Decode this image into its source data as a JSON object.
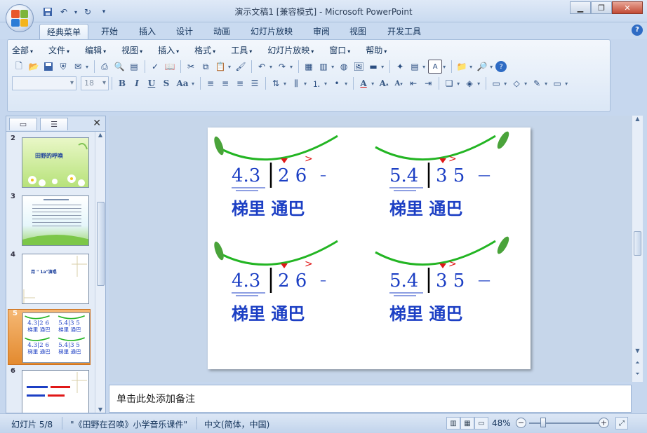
{
  "window": {
    "title": "演示文稿1 [兼容模式] - Microsoft PowerPoint",
    "controls": [
      "minimize",
      "restore",
      "close"
    ]
  },
  "quick_access": [
    {
      "name": "save-icon"
    },
    {
      "name": "undo-icon"
    },
    {
      "name": "redo-icon"
    },
    {
      "name": "customize-icon"
    }
  ],
  "tabs": [
    "经典菜单",
    "开始",
    "插入",
    "设计",
    "动画",
    "幻灯片放映",
    "审阅",
    "视图",
    "开发工具"
  ],
  "active_tab": "经典菜单",
  "menus": [
    "全部",
    "文件",
    "编辑",
    "视图",
    "插入",
    "格式",
    "工具",
    "幻灯片放映",
    "窗口",
    "帮助"
  ],
  "format": {
    "font_name": "",
    "font_size": "18",
    "bold": "B",
    "italic": "I",
    "underline": "U",
    "strike": "S",
    "case": "Aa"
  },
  "slides": [
    {
      "number": "2",
      "title": "田野的呼唤"
    },
    {
      "number": "3",
      "title": ""
    },
    {
      "number": "4",
      "title": "用 \" 1a\"演唱"
    },
    {
      "number": "5",
      "title": "",
      "selected": true
    },
    {
      "number": "6",
      "title": ""
    }
  ],
  "current_slide": {
    "blocks": [
      {
        "notes": "4.3",
        "after_bar": "2  6",
        "dash": "–",
        "lyrics": "梯里 通巴",
        "accent": ">"
      },
      {
        "notes": "5.4",
        "after_bar": "3  5",
        "dash": "—",
        "lyrics": "梯里 通巴",
        "accent": ">"
      },
      {
        "notes": "4.3",
        "after_bar": "2  6",
        "dash": "–",
        "lyrics": "梯里 通巴",
        "accent": ">"
      },
      {
        "notes": "5.4",
        "after_bar": "3  5",
        "dash": "—",
        "lyrics": "梯里 通巴",
        "accent": ">"
      }
    ]
  },
  "notes_placeholder": "单击此处添加备注",
  "status": {
    "slide_info": "幻灯片 5/8",
    "theme": "\"《田野在召唤》小学音乐课件\"",
    "language": "中文(简体，中国)",
    "zoom": "48%",
    "zoom_fraction": 0.48
  },
  "colors": {
    "note_blue": "#1c3fc4",
    "vine_green": "#23b523",
    "leaf_green": "#4aa33a",
    "accent_red": "#e01818"
  }
}
